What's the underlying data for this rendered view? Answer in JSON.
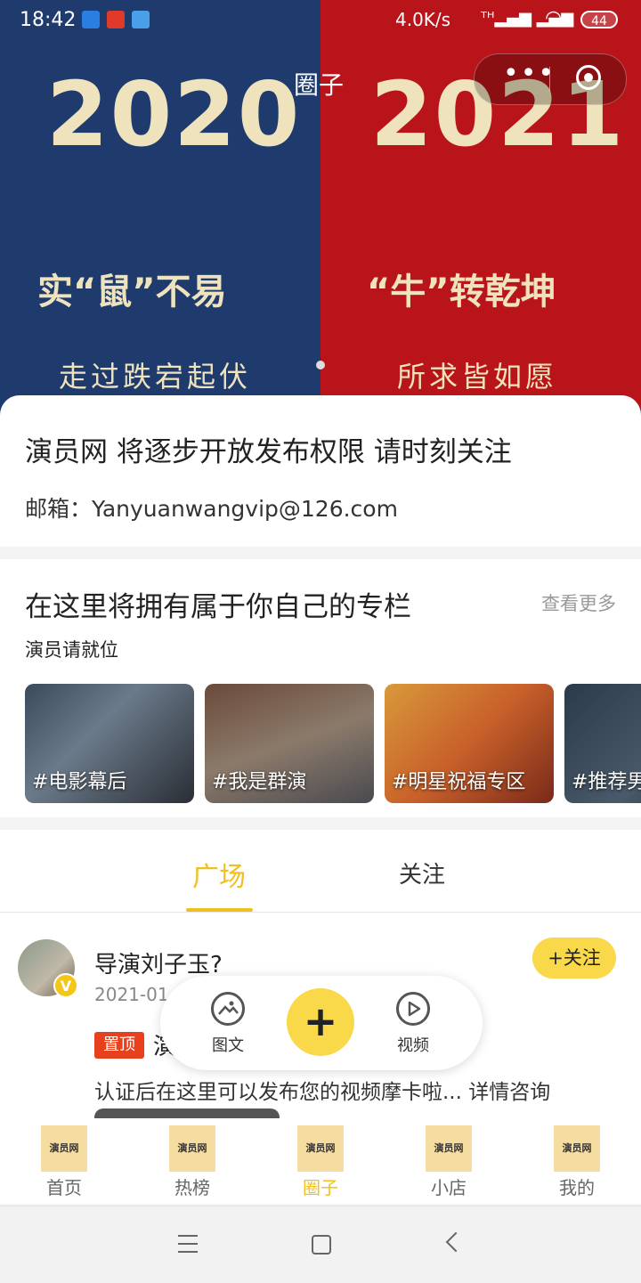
{
  "status_bar": {
    "time": "18:42",
    "speed": "4.0K/s",
    "battery": "44"
  },
  "banner": {
    "left_year": "2020",
    "right_year": "2021",
    "left_slogan": "实“鼠”不易",
    "right_slogan": "“牛”转乾坤",
    "left_sub": "走过跌宕起伏",
    "right_sub": "所求皆如愿",
    "left_bg": "#1f3b6e",
    "right_bg": "#b8141a"
  },
  "mini_program": {
    "title": "圈子",
    "more_icon": "more-dots-icon",
    "close_icon": "target-icon"
  },
  "notice": {
    "headline": "演员网 将逐步开放发布权限 请时刻关注",
    "email": "邮箱：Yanyuanwangvip@126.com"
  },
  "columns": {
    "heading": "在这里将拥有属于你自己的专栏",
    "more": "查看更多",
    "subheading": "演员请就位",
    "cards": [
      {
        "label": "#电影幕后"
      },
      {
        "label": "#我是群演"
      },
      {
        "label": "#明星祝福专区"
      },
      {
        "label": "#推荐男"
      }
    ]
  },
  "tabs": [
    {
      "label": "广场",
      "active": true
    },
    {
      "label": "关注",
      "active": false
    }
  ],
  "post": {
    "title": "导演刘子玉?",
    "date": "2021-01",
    "follow": "+关注",
    "pin": "置顶",
    "pin_text": "演",
    "body": "认证后在这里可以发布您的视频摩卡啦... 详情咨询"
  },
  "publish": {
    "tuwen": "图文",
    "plus": "+",
    "video": "视频"
  },
  "bottom_nav": {
    "logo_text": "演员网",
    "items": [
      {
        "label": "首页"
      },
      {
        "label": "热榜"
      },
      {
        "label": "圈子",
        "active": true
      },
      {
        "label": "小店"
      },
      {
        "label": "我的"
      }
    ]
  },
  "accent_color": "#f0c020"
}
